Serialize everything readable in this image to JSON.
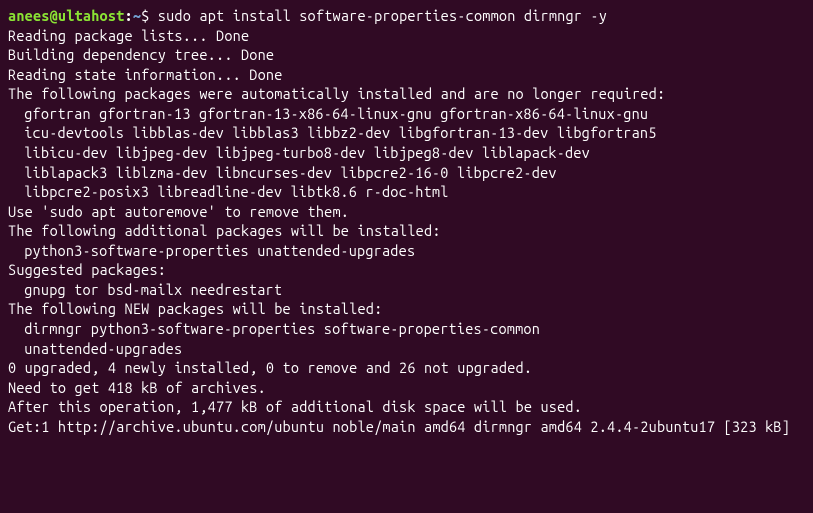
{
  "prompt": {
    "userhost": "anees@ultahost",
    "sep": ":",
    "path": "~",
    "dollar": "$"
  },
  "command": " sudo apt install software-properties-common dirmngr -y",
  "lines": {
    "l01": "Reading package lists... Done",
    "l02": "Building dependency tree... Done",
    "l03": "Reading state information... Done",
    "l04": "The following packages were automatically installed and are no longer required:",
    "l05": "gfortran gfortran-13 gfortran-13-x86-64-linux-gnu gfortran-x86-64-linux-gnu",
    "l06": "icu-devtools libblas-dev libblas3 libbz2-dev libgfortran-13-dev libgfortran5",
    "l07": "libicu-dev libjpeg-dev libjpeg-turbo8-dev libjpeg8-dev liblapack-dev",
    "l08": "liblapack3 liblzma-dev libncurses-dev libpcre2-16-0 libpcre2-dev",
    "l09": "libpcre2-posix3 libreadline-dev libtk8.6 r-doc-html",
    "l10": "Use 'sudo apt autoremove' to remove them.",
    "l11": "The following additional packages will be installed:",
    "l12": "python3-software-properties unattended-upgrades",
    "l13": "Suggested packages:",
    "l14": "gnupg tor bsd-mailx needrestart",
    "l15": "The following NEW packages will be installed:",
    "l16": "dirmngr python3-software-properties software-properties-common",
    "l17": "unattended-upgrades",
    "l18": "0 upgraded, 4 newly installed, 0 to remove and 26 not upgraded.",
    "l19": "Need to get 418 kB of archives.",
    "l20": "After this operation, 1,477 kB of additional disk space will be used.",
    "l21": "Get:1 http://archive.ubuntu.com/ubuntu noble/main amd64 dirmngr amd64 2.4.4-2ubuntu17 [323 kB]"
  }
}
